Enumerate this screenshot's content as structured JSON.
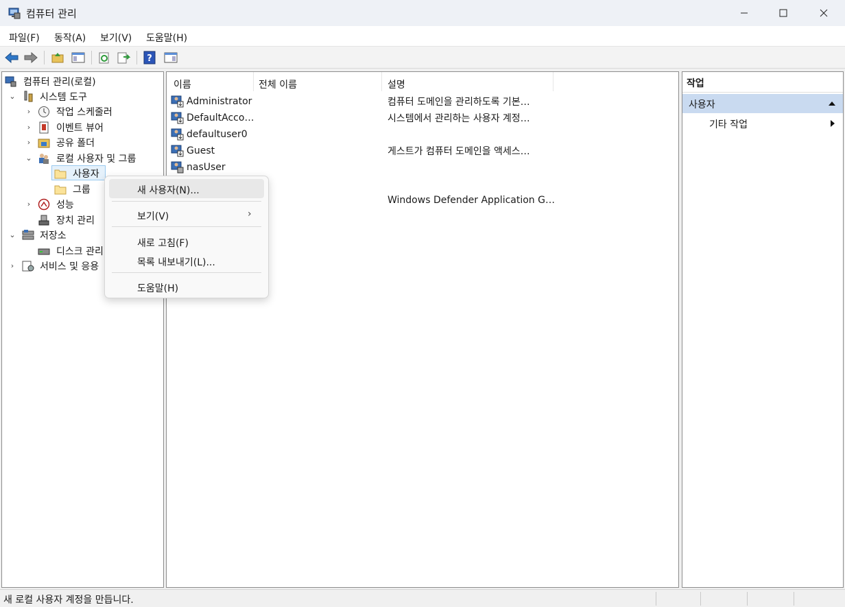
{
  "window": {
    "title": "컴퓨터 관리",
    "minimize_icon": "minimize-icon",
    "maximize_icon": "maximize-icon",
    "close_icon": "close-icon"
  },
  "menubar": [
    "파일(F)",
    "동작(A)",
    "보기(V)",
    "도움말(H)"
  ],
  "toolbar": {
    "icons": [
      "back-arrow-icon",
      "forward-arrow-icon",
      "up-folder-icon",
      "show-hide-tree-icon",
      "refresh-icon",
      "export-list-icon",
      "help-icon",
      "show-hide-action-pane-icon"
    ]
  },
  "tree": {
    "root": "컴퓨터 관리(로컬)",
    "system_tools": "시스템 도구",
    "task_scheduler": "작업 스케줄러",
    "event_viewer": "이벤트 뷰어",
    "shared_folders": "공유 폴더",
    "local_users_groups": "로컬 사용자 및 그룹",
    "users": "사용자",
    "groups": "그룹",
    "performance": "성능",
    "device_manager": "장치 관리",
    "storage": "저장소",
    "disk_management": "디스크 관리",
    "services_apps": "서비스 및 응용"
  },
  "list": {
    "columns": [
      "이름",
      "전체 이름",
      "설명"
    ],
    "rows": [
      {
        "name": "Administrator",
        "full_name": "",
        "description": "컴퓨터 도메인을 관리하도록 기본…"
      },
      {
        "name": "DefaultAcco…",
        "full_name": "",
        "description": "시스템에서 관리하는 사용자 계정…"
      },
      {
        "name": "defaultuser0",
        "full_name": "",
        "description": ""
      },
      {
        "name": "Guest",
        "full_name": "",
        "description": "게스트가 컴퓨터 도메인을 액세스…"
      },
      {
        "name": "nasUser",
        "full_name": "",
        "description": ""
      },
      {
        "name": "",
        "full_name": "",
        "description": ""
      },
      {
        "name": "",
        "full_name": "",
        "description": "Windows Defender Application G…"
      }
    ]
  },
  "actions": {
    "header": "작업",
    "section": "사용자",
    "more_actions": "기타 작업"
  },
  "context_menu": {
    "new_user": "새 사용자(N)...",
    "view": "보기(V)",
    "refresh": "새로 고침(F)",
    "export_list": "목록 내보내기(L)...",
    "help": "도움말(H)"
  },
  "status": {
    "text": "새 로컬 사용자 계정을 만듭니다."
  }
}
